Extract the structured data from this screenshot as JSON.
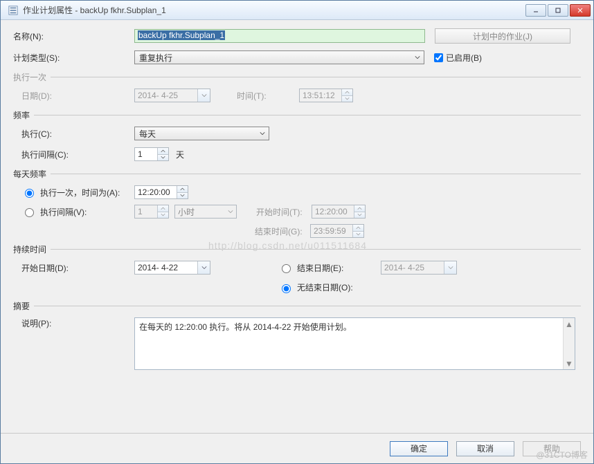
{
  "title": "作业计划属性 - backUp fkhr.Subplan_1",
  "watermark": "@31CTO博客",
  "bg_watermark": "http://blog.csdn.net/u011511684",
  "labels": {
    "name": "名称(N):",
    "schedule_type": "计划类型(S):",
    "enabled": "已启用(B)",
    "jobs_button": "计划中的作业(J)",
    "exec_once_section": "执行一次",
    "date": "日期(D):",
    "time": "时间(T):",
    "frequency_section": "频率",
    "exec": "执行(C):",
    "interval": "执行间隔(C):",
    "interval_unit": "天",
    "daily_section": "每天频率",
    "once_at": "执行一次，时间为(A):",
    "each_interval": "执行间隔(V):",
    "interval_unit2": "小时",
    "start_time": "开始时间(T):",
    "end_time": "结束时间(G):",
    "duration_section": "持续时间",
    "start_date": "开始日期(D):",
    "end_date": "结束日期(E):",
    "no_end": "无结束日期(O):",
    "summary_section": "摘要",
    "description": "说明(P):"
  },
  "values": {
    "name": "backUp fkhr.Subplan_1",
    "schedule_type": "重复执行",
    "enabled": true,
    "exec_once_date": "2014- 4-25",
    "exec_once_time": "13:51:12",
    "frequency": "每天",
    "interval": "1",
    "once_time": "12:20:00",
    "daily_radio": "once",
    "each_interval_val": "1",
    "start_time": "12:20:00",
    "end_time": "23:59:59",
    "start_date": "2014- 4-22",
    "end_date": "2014- 4-25",
    "end_radio": "noend",
    "description": "在每天的 12:20:00 执行。将从 2014-4-22 开始使用计划。"
  },
  "footer": {
    "ok": "确定",
    "cancel": "取消",
    "help": "帮助"
  }
}
